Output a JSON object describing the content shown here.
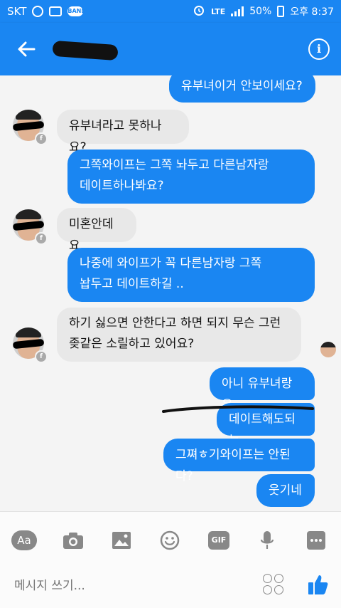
{
  "status_bar": {
    "carrier": "SKT",
    "band_label": "BAND",
    "network": "LTE",
    "battery": "50%",
    "time": "오후 8:37"
  },
  "header": {
    "contact_name": ""
  },
  "messages": [
    {
      "from": "me",
      "text": "유부녀이거 안보이세요?"
    },
    {
      "from": "them",
      "text": "유부녀라고 못하나요?"
    },
    {
      "from": "me",
      "lines": [
        "그쪽와이프는 그쪽 놔두고 다른남자랑",
        "데이트하나봐요?"
      ]
    },
    {
      "from": "them",
      "text": "미혼안데요"
    },
    {
      "from": "me",
      "lines": [
        "나중에 와이프가 꼭 다른남자랑 그쪽",
        "놥두고 데이트하길 .."
      ]
    },
    {
      "from": "them",
      "lines": [
        "하기 싫으면 안한다고 하면 되지 무슨 그런",
        "좆같은 소릴하고 있어요?"
      ]
    },
    {
      "from": "me",
      "text": "아니 유부녀랑은"
    },
    {
      "from": "me",
      "text": "데이트해도되는"
    },
    {
      "from": "me",
      "text": "그쪄ㅎ기와이프는 안된다?"
    },
    {
      "from": "me",
      "text": "웃기네"
    }
  ],
  "composer": {
    "tools": [
      "text-style",
      "camera",
      "gallery",
      "emoji",
      "gif",
      "microphone",
      "more"
    ],
    "aa_label": "Aa",
    "gif_label": "GIF",
    "placeholder": "메시지 쓰기..."
  },
  "colors": {
    "accent": "#1a86f2",
    "incoming_bubble": "#e8e8e8",
    "background": "#f4f4f4"
  }
}
